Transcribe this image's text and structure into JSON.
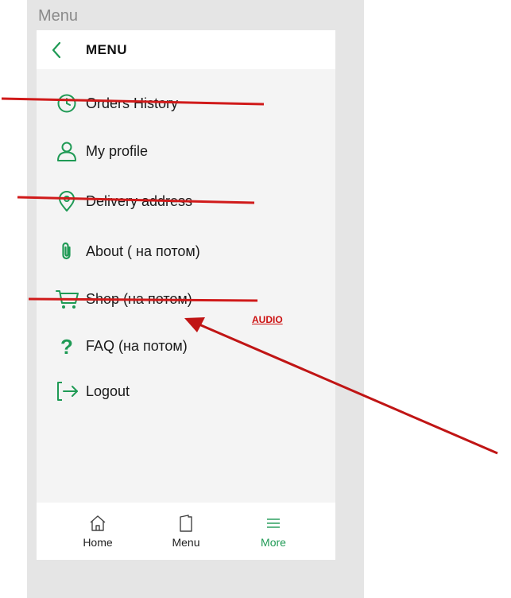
{
  "frame_title": "Menu",
  "header": {
    "title": "MENU"
  },
  "menu": {
    "items": [
      {
        "label": "Orders History"
      },
      {
        "label": "My profile"
      },
      {
        "label": "Delivery address"
      },
      {
        "label": "About ( на потом)"
      },
      {
        "label": "Shop (на потом)"
      },
      {
        "label": "FAQ (на потом)"
      },
      {
        "label": "Logout"
      }
    ]
  },
  "bottom_nav": {
    "items": [
      {
        "label": "Home",
        "icon": "home-icon"
      },
      {
        "label": "Menu",
        "icon": "menu-book-icon"
      },
      {
        "label": "More",
        "icon": "hamburger-icon",
        "active": true
      }
    ]
  },
  "annotations": {
    "audio_label": "AUDIO"
  },
  "colors": {
    "accent": "#1f9a55",
    "annotation": "#cc1111",
    "background": "#f4f4f4",
    "frame": "#e5e5e5"
  }
}
